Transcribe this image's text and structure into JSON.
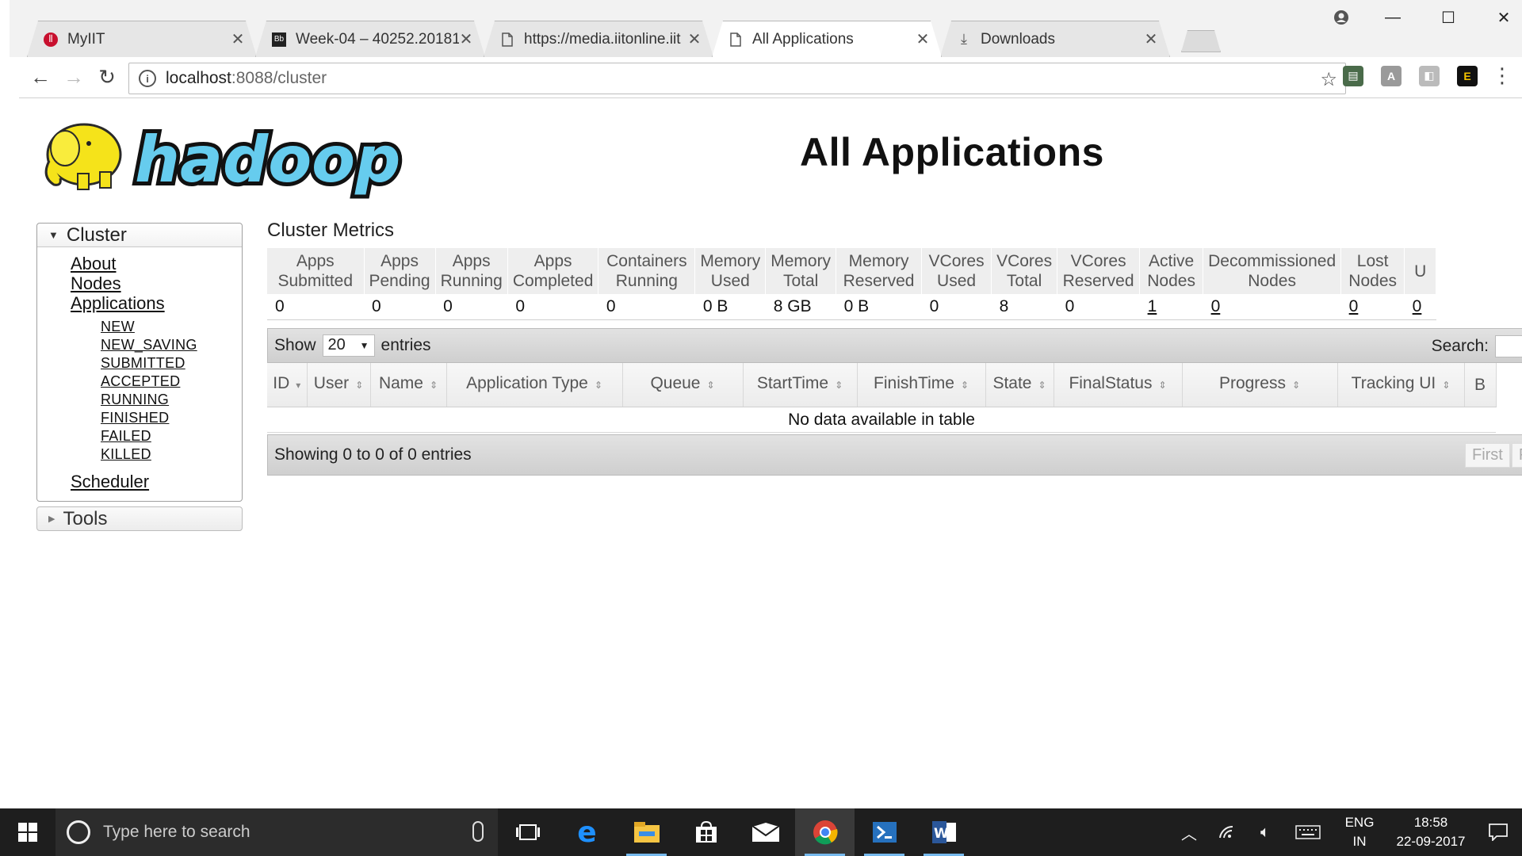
{
  "browser": {
    "tabs": [
      {
        "title": "MyIIT",
        "icon": "iit-favicon",
        "active": false
      },
      {
        "title": "Week-04 – 40252.20181(",
        "icon": "blackboard-favicon",
        "active": false
      },
      {
        "title": "https://media.iitonline.iit",
        "icon": "page-icon",
        "active": false
      },
      {
        "title": "All Applications",
        "icon": "page-icon",
        "active": true
      },
      {
        "title": "Downloads",
        "icon": "download-icon",
        "active": false
      }
    ],
    "close_glyph": "✕",
    "address": {
      "host": "localhost",
      "path": ":8088/cluster"
    }
  },
  "page": {
    "title": "All Applications",
    "logo_text": "hadoop"
  },
  "sidebar": {
    "cluster_label": "Cluster",
    "links": [
      "About",
      "Nodes",
      "Applications"
    ],
    "app_states": [
      "NEW",
      "NEW_SAVING",
      "SUBMITTED",
      "ACCEPTED",
      "RUNNING",
      "FINISHED",
      "FAILED",
      "KILLED"
    ],
    "scheduler_label": "Scheduler",
    "tools_label": "Tools"
  },
  "metrics": {
    "title": "Cluster Metrics",
    "headers": [
      [
        "Apps",
        "Submitted"
      ],
      [
        "Apps",
        "Pending"
      ],
      [
        "Apps",
        "Running"
      ],
      [
        "Apps",
        "Completed"
      ],
      [
        "Containers",
        "Running"
      ],
      [
        "Memory",
        "Used"
      ],
      [
        "Memory",
        "Total"
      ],
      [
        "Memory",
        "Reserved"
      ],
      [
        "VCores",
        "Used"
      ],
      [
        "VCores",
        "Total"
      ],
      [
        "VCores",
        "Reserved"
      ],
      [
        "Active",
        "Nodes"
      ],
      [
        "Decommissioned",
        "Nodes"
      ],
      [
        "Lost",
        "Nodes"
      ],
      [
        "U",
        ""
      ]
    ],
    "values": [
      {
        "v": "0",
        "link": false
      },
      {
        "v": "0",
        "link": false
      },
      {
        "v": "0",
        "link": false
      },
      {
        "v": "0",
        "link": false
      },
      {
        "v": "0",
        "link": false
      },
      {
        "v": "0 B",
        "link": false
      },
      {
        "v": "8 GB",
        "link": false
      },
      {
        "v": "0 B",
        "link": false
      },
      {
        "v": "0",
        "link": false
      },
      {
        "v": "8",
        "link": false
      },
      {
        "v": "0",
        "link": false
      },
      {
        "v": "1",
        "link": true
      },
      {
        "v": "0",
        "link": true
      },
      {
        "v": "0",
        "link": true
      },
      {
        "v": "0",
        "link": true
      }
    ]
  },
  "datatable": {
    "show_label": "Show",
    "page_length": "20",
    "entries_label": "entries",
    "search_label": "Search:",
    "columns": [
      {
        "label": [
          "ID"
        ],
        "sort": "▾"
      },
      {
        "label": [
          "User"
        ],
        "sort": "⇕"
      },
      {
        "label": [
          "Name"
        ],
        "sort": "⇕"
      },
      {
        "label": [
          "Application Type"
        ],
        "sort": "⇕"
      },
      {
        "label": [
          "Queue"
        ],
        "sort": "⇕"
      },
      {
        "label": [
          "StartTime"
        ],
        "sort": "⇕"
      },
      {
        "label": [
          "FinishTime"
        ],
        "sort": "⇕"
      },
      {
        "label": [
          "State"
        ],
        "sort": "⇕"
      },
      {
        "label": [
          "FinalStatus"
        ],
        "sort": "⇕"
      },
      {
        "label": [
          "Progress"
        ],
        "sort": "⇕"
      },
      {
        "label": [
          "Tracking UI"
        ],
        "sort": "⇕"
      },
      {
        "label": [
          "B"
        ],
        "sort": ""
      }
    ],
    "empty_message": "No data available in table",
    "info": "Showing 0 to 0 of 0 entries",
    "pager": [
      "First",
      "Pre"
    ]
  },
  "taskbar": {
    "search_placeholder": "Type here to search",
    "lang_top": "ENG",
    "lang_bottom": "IN",
    "time": "18:58",
    "date": "22-09-2017"
  }
}
